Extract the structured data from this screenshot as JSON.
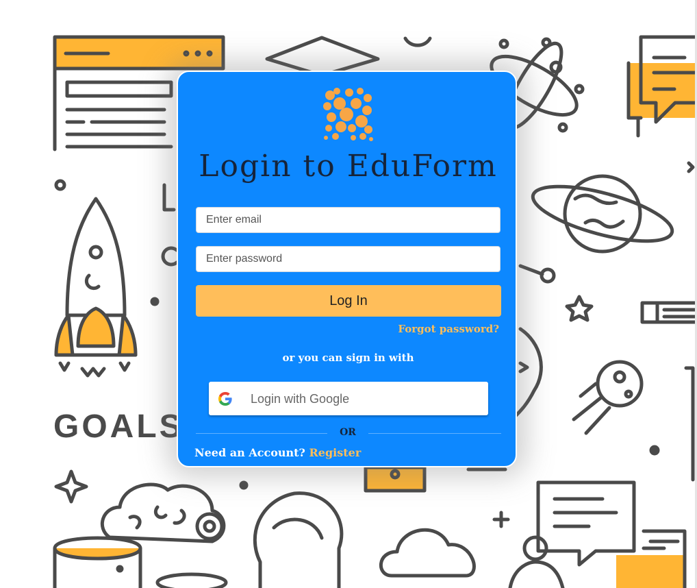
{
  "background": {
    "goals_text": "GOALS",
    "accent_color": "#ffb534",
    "line_color": "#4a4a4a"
  },
  "login": {
    "title": "Login to EduForm",
    "email_placeholder": "Enter email",
    "password_placeholder": "Enter password",
    "login_button": "Log In",
    "forgot_password": "Forgot password?",
    "alt_signin_text": "or you can sign in with",
    "google_button": "Login with Google",
    "or_text": "OR",
    "need_account": "Need an Account?",
    "register_link": "Register"
  },
  "colors": {
    "card": "#0d88ff",
    "button": "#ffbe5a",
    "link": "#ffbe5a",
    "title": "#16243a"
  },
  "icons": {
    "logo": "eduform-logo-icon",
    "google": "google-icon"
  }
}
